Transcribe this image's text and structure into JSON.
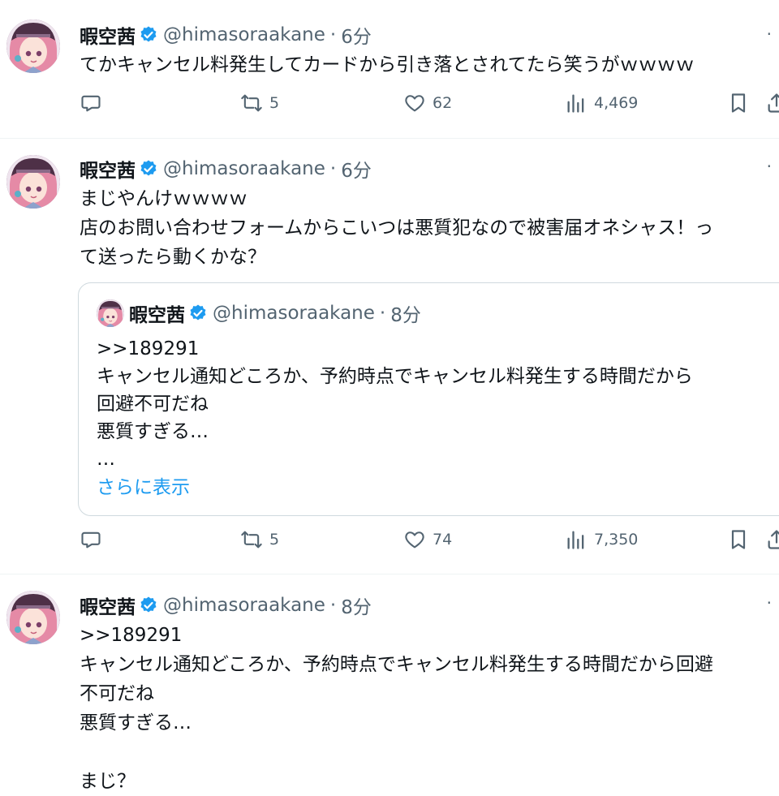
{
  "tweets": [
    {
      "name": "暇空茜",
      "handle": "@himasoraakane",
      "time": "6分",
      "text": "てかキャンセル料発生してカードから引き落とされてたら笑うがｗｗｗｗ",
      "retweets": "5",
      "likes": "62",
      "views": "4,469"
    },
    {
      "name": "暇空茜",
      "handle": "@himasoraakane",
      "time": "6分",
      "text": "まじやんけｗｗｗｗ\n店のお問い合わせフォームからこいつは悪質犯なので被害届オネシャス！っ\nて送ったら動くかな？",
      "retweets": "5",
      "likes": "74",
      "views": "7,350",
      "quote": {
        "name": "暇空茜",
        "handle": "@himasoraakane",
        "time": "8分",
        "text": ">>189291\nキャンセル通知どころか、予約時点でキャンセル料発生する時間だから\n回避不可だね\n悪質すぎる…\n…",
        "show_more": "さらに表示"
      }
    },
    {
      "name": "暇空茜",
      "handle": "@himasoraakane",
      "time": "8分",
      "text": ">>189291\nキャンセル通知どころか、予約時点でキャンセル料発生する時間だから回避\n不可だね\n悪質すぎる…\n\nまじ？"
    }
  ],
  "icons": {
    "reply": "speech-bubble-icon",
    "retweet": "retweet-arrows-icon",
    "like": "heart-icon",
    "views": "bar-chart-icon",
    "bookmark": "bookmark-icon",
    "share": "share-icon",
    "more": "more-dots-icon",
    "verified": "verified-badge-icon"
  },
  "colors": {
    "text": "#0f1419",
    "secondary": "#536471",
    "link": "#1d9bf0",
    "verified": "#1d9bf0",
    "border": "#cfd9de"
  }
}
